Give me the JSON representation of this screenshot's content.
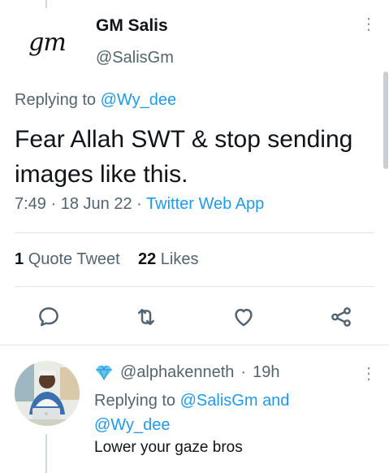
{
  "tweet": {
    "author_name": "GM Salis",
    "author_handle": "@SalisGm",
    "logo_text": "gm",
    "replying_prefix": "Replying to",
    "replying_to": "@Wy_dee",
    "text": "Fear Allah SWT & stop sending images like this.",
    "time": "7:49",
    "date": "18 Jun 22",
    "source": "Twitter Web App",
    "separator": "·",
    "quote_count": "1",
    "quote_label": "Quote Tweet",
    "likes_count": "22",
    "likes_label": "Likes"
  },
  "actions": {
    "reply_icon": "reply-icon",
    "retweet_icon": "retweet-icon",
    "like_icon": "heart-icon",
    "share_icon": "share-icon"
  },
  "reply": {
    "badge_icon": "diamond-icon",
    "handle": "@alphakenneth",
    "time": "19h",
    "separator": "·",
    "replying_prefix": "Replying to",
    "mention_1": "@SalisGm",
    "conjunction": "and",
    "mention_2": "@Wy_dee",
    "text": "Lower your gaze bros"
  },
  "colors": {
    "accent": "#1d9bf0",
    "secondary_text": "#536471",
    "primary_text": "#0f1419"
  }
}
